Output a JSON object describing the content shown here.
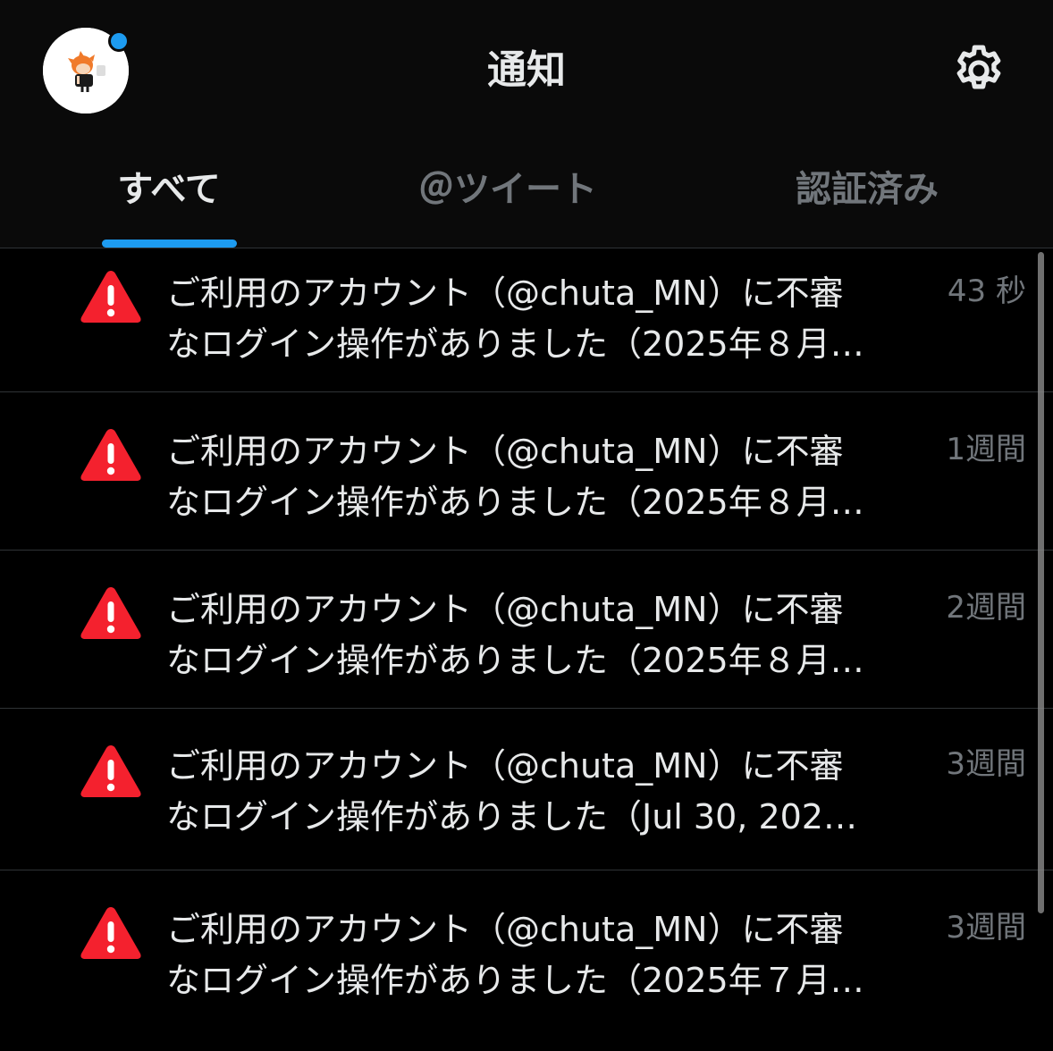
{
  "header": {
    "title": "通知",
    "avatar_icon": "avatar-image",
    "settings_icon": "gear-icon",
    "notification_dot_color": "#1d9bf0"
  },
  "tabs": [
    {
      "label": "すべて",
      "active": true
    },
    {
      "label": "＠ツイート",
      "active": false
    },
    {
      "label": "認証済み",
      "active": false
    }
  ],
  "notifications": [
    {
      "icon": "warning-icon",
      "line1": "ご利用のアカウント（@chuta_MN）に不審",
      "line2": "なログイン操作がありました（2025年８月…",
      "time": "43 秒"
    },
    {
      "icon": "warning-icon",
      "line1": "ご利用のアカウント（@chuta_MN）に不審",
      "line2": "なログイン操作がありました（2025年８月…",
      "time": "1週間"
    },
    {
      "icon": "warning-icon",
      "line1": "ご利用のアカウント（@chuta_MN）に不審",
      "line2": "なログイン操作がありました（2025年８月…",
      "time": "2週間"
    },
    {
      "icon": "warning-icon",
      "line1": "ご利用のアカウント（@chuta_MN）に不審",
      "line2": "なログイン操作がありました（Jul 30, 202…",
      "time": "3週間"
    },
    {
      "icon": "warning-icon",
      "line1": "ご利用のアカウント（@chuta_MN）に不審",
      "line2": "なログイン操作がありました（2025年７月…",
      "time": "3週間"
    }
  ],
  "colors": {
    "background": "#000000",
    "accent": "#1d9bf0",
    "warning": "#f4212e",
    "muted_text": "#71767b"
  }
}
